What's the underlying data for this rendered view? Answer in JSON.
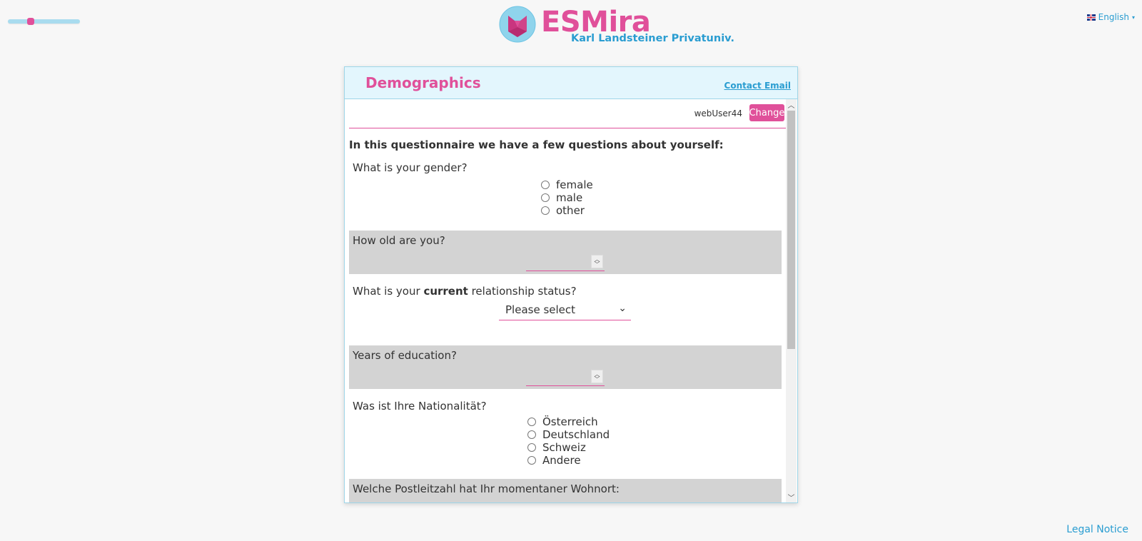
{
  "app": {
    "brand": "ESMira",
    "institution": "Karl Landsteiner Privatuniv.",
    "language": "English",
    "slider_value": 0.3
  },
  "colors": {
    "accent": "#e0509a",
    "link": "#2a9dd1",
    "header_bg": "#e3f6fd"
  },
  "panel": {
    "title": "Demographics",
    "contact_email_label": "Contact Email",
    "username": "webUser44",
    "change_label": "Change",
    "intro": "In this questionnaire we have a few questions about yourself:"
  },
  "questions": {
    "gender": {
      "label": "What is your gender?",
      "options": [
        "female",
        "male",
        "other"
      ]
    },
    "age": {
      "label": "How old are you?",
      "value": ""
    },
    "relationship": {
      "label_pre": "What is your ",
      "label_bold": "current",
      "label_post": " relationship status?",
      "selected": "Please select"
    },
    "education": {
      "label": "Years of education?",
      "value": ""
    },
    "nationality": {
      "label": "Was ist Ihre Nationalität?",
      "options": [
        "Österreich",
        "Deutschland",
        "Schweiz",
        "Andere"
      ]
    },
    "postcode": {
      "label": "Welche Postleitzahl hat Ihr momentaner Wohnort:"
    }
  },
  "footer": {
    "legal_notice": "Legal Notice"
  },
  "icons": [
    "esmira-logo-icon",
    "uk-flag-icon",
    "caret-down-icon",
    "chevron-down-icon",
    "spinner-icon",
    "scroll-up-icon",
    "scroll-down-icon"
  ]
}
